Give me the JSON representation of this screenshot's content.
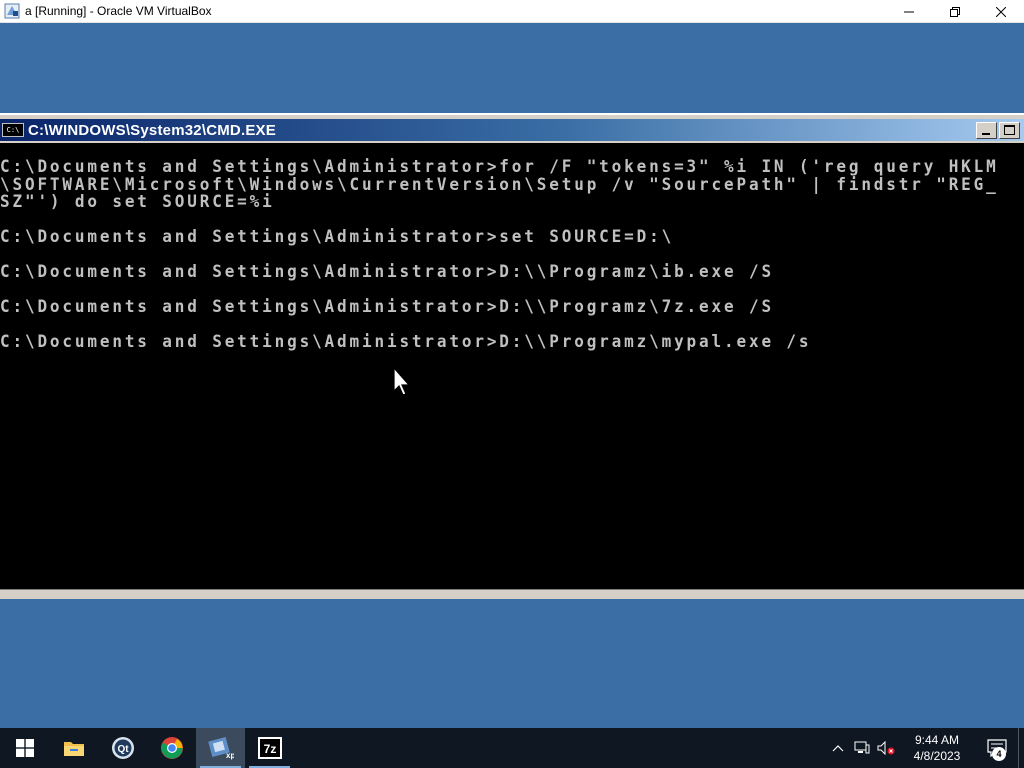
{
  "host_window": {
    "title": "a [Running] - Oracle VM VirtualBox",
    "icon": "virtualbox-icon",
    "controls": [
      "minimize",
      "restore",
      "close"
    ]
  },
  "cmd_window": {
    "title": "C:\\WINDOWS\\System32\\CMD.EXE",
    "icon_label": "C:\\",
    "console_lines": [
      "C:\\Documents and Settings\\Administrator>for /F \"tokens=3\" %i IN ('reg query HKLM",
      "\\SOFTWARE\\Microsoft\\Windows\\CurrentVersion\\Setup /v \"SourcePath\" | findstr \"REG_",
      "SZ\"') do set SOURCE=%i",
      "",
      "C:\\Documents and Settings\\Administrator>set SOURCE=D:\\",
      "",
      "C:\\Documents and Settings\\Administrator>D:\\\\Programz\\ib.exe /S",
      "",
      "C:\\Documents and Settings\\Administrator>D:\\\\Programz\\7z.exe /S",
      "",
      "C:\\Documents and Settings\\Administrator>D:\\\\Programz\\mypal.exe /s"
    ]
  },
  "taskbar": {
    "items": [
      {
        "name": "start-button",
        "icon": "windows-logo-icon"
      },
      {
        "name": "file-explorer",
        "icon": "folder-icon"
      },
      {
        "name": "qt-creator",
        "icon": "qt-icon"
      },
      {
        "name": "chrome",
        "icon": "chrome-icon"
      },
      {
        "name": "virtualbox",
        "icon": "virtualbox-xp-icon"
      },
      {
        "name": "7zip",
        "icon": "7zip-icon",
        "label": "7z"
      }
    ],
    "tray": {
      "time": "9:44 AM",
      "date": "4/8/2023",
      "notification_count": "4"
    }
  }
}
